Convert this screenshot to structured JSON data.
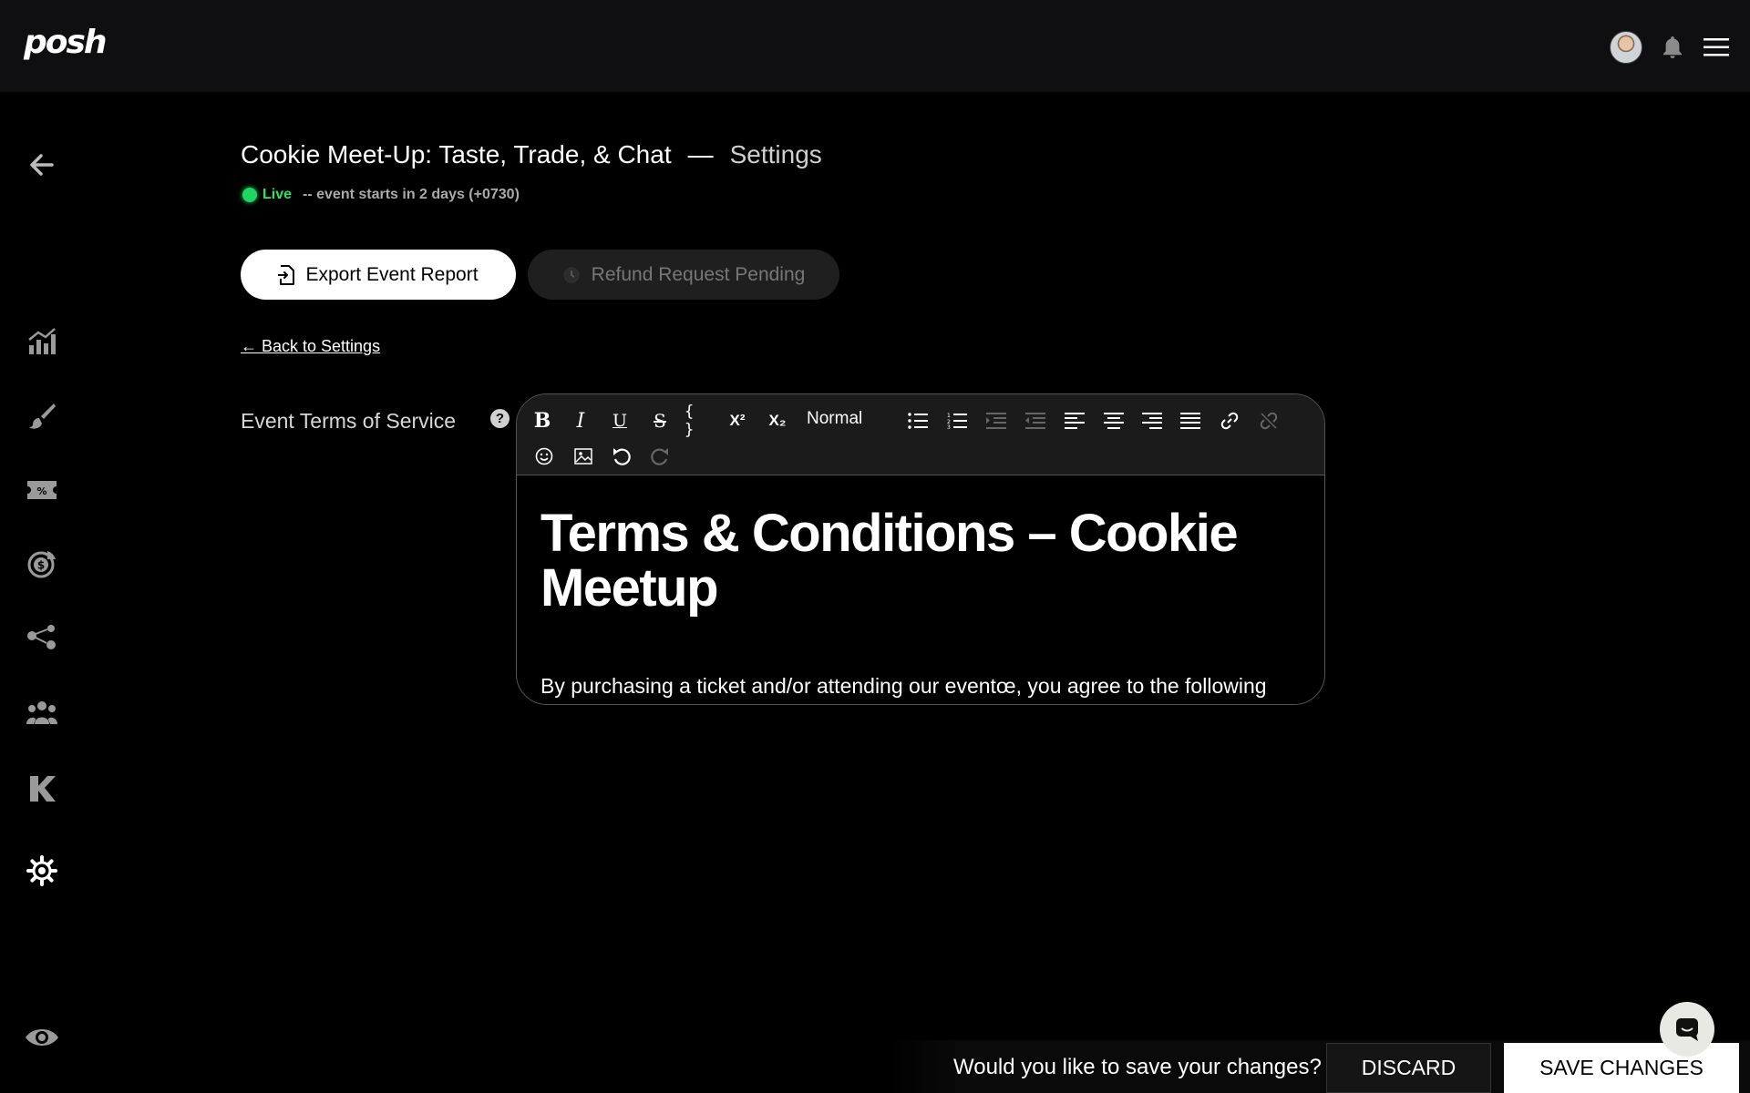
{
  "header": {
    "logo": "posh",
    "avatar_alt": "user-avatar"
  },
  "sidebar": {
    "items": [
      {
        "name": "back-arrow-icon"
      },
      {
        "name": "analytics-icon"
      },
      {
        "name": "brush-icon"
      },
      {
        "name": "ticket-icon"
      },
      {
        "name": "finance-icon"
      },
      {
        "name": "network-icon"
      },
      {
        "name": "team-icon"
      },
      {
        "name": "kickback-icon"
      },
      {
        "name": "settings-icon"
      },
      {
        "name": "preview-eye-icon"
      }
    ]
  },
  "page": {
    "title": "Cookie Meet-Up: Taste, Trade, & Chat",
    "separator": "—",
    "section": "Settings",
    "live_label": "Live",
    "starts_text": "-- event starts in 2 days (+0730)"
  },
  "actions": {
    "export_label": "Export Event Report",
    "refund_label": "Refund Request Pending",
    "back_link": "← Back to Settings"
  },
  "form": {
    "tos_label": "Event Terms of Service",
    "help": "?"
  },
  "editor": {
    "toolbar": {
      "bold": "B",
      "italic": "I",
      "underline": "U",
      "strike": "S",
      "code": "{ }",
      "superscript": "X²",
      "subscript": "X₂",
      "heading_select": "Normal"
    },
    "doc_title": "Terms & Conditions – Cookie Meetup",
    "doc_paragraph": "By purchasing a ticket and/or attending our eventœ, you agree to the following"
  },
  "savebar": {
    "question": "Would you like to save your changes?",
    "discard": "DISCARD",
    "save": "SAVE CHANGES"
  },
  "colors": {
    "live": "#1ed760",
    "background": "#000000",
    "topbar": "#0f0f12"
  }
}
